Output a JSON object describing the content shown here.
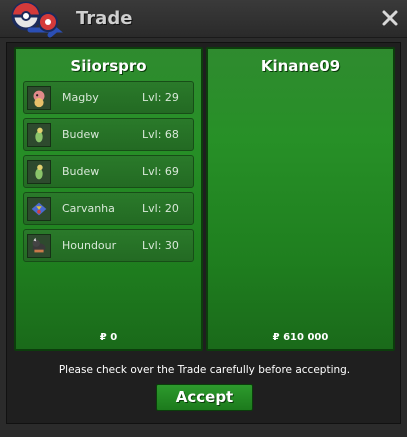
{
  "window": {
    "title": "Trade",
    "close_icon": "close-icon"
  },
  "left_panel": {
    "trainer": "Siiorspro",
    "pokemon": [
      {
        "name": "Magby",
        "level": "Lvl: 29",
        "icon": "magby-icon"
      },
      {
        "name": "Budew",
        "level": "Lvl: 68",
        "icon": "budew-icon"
      },
      {
        "name": "Budew",
        "level": "Lvl: 69",
        "icon": "budew-icon"
      },
      {
        "name": "Carvanha",
        "level": "Lvl: 20",
        "icon": "carvanha-icon"
      },
      {
        "name": "Houndour",
        "level": "Lvl: 30",
        "icon": "houndour-icon"
      }
    ],
    "money": "₽ 0"
  },
  "right_panel": {
    "trainer": "Kinane09",
    "pokemon": [],
    "money": "₽ 610 000"
  },
  "footer": {
    "notice": "Please check over the Trade carefully before accepting.",
    "accept_label": "Accept"
  }
}
